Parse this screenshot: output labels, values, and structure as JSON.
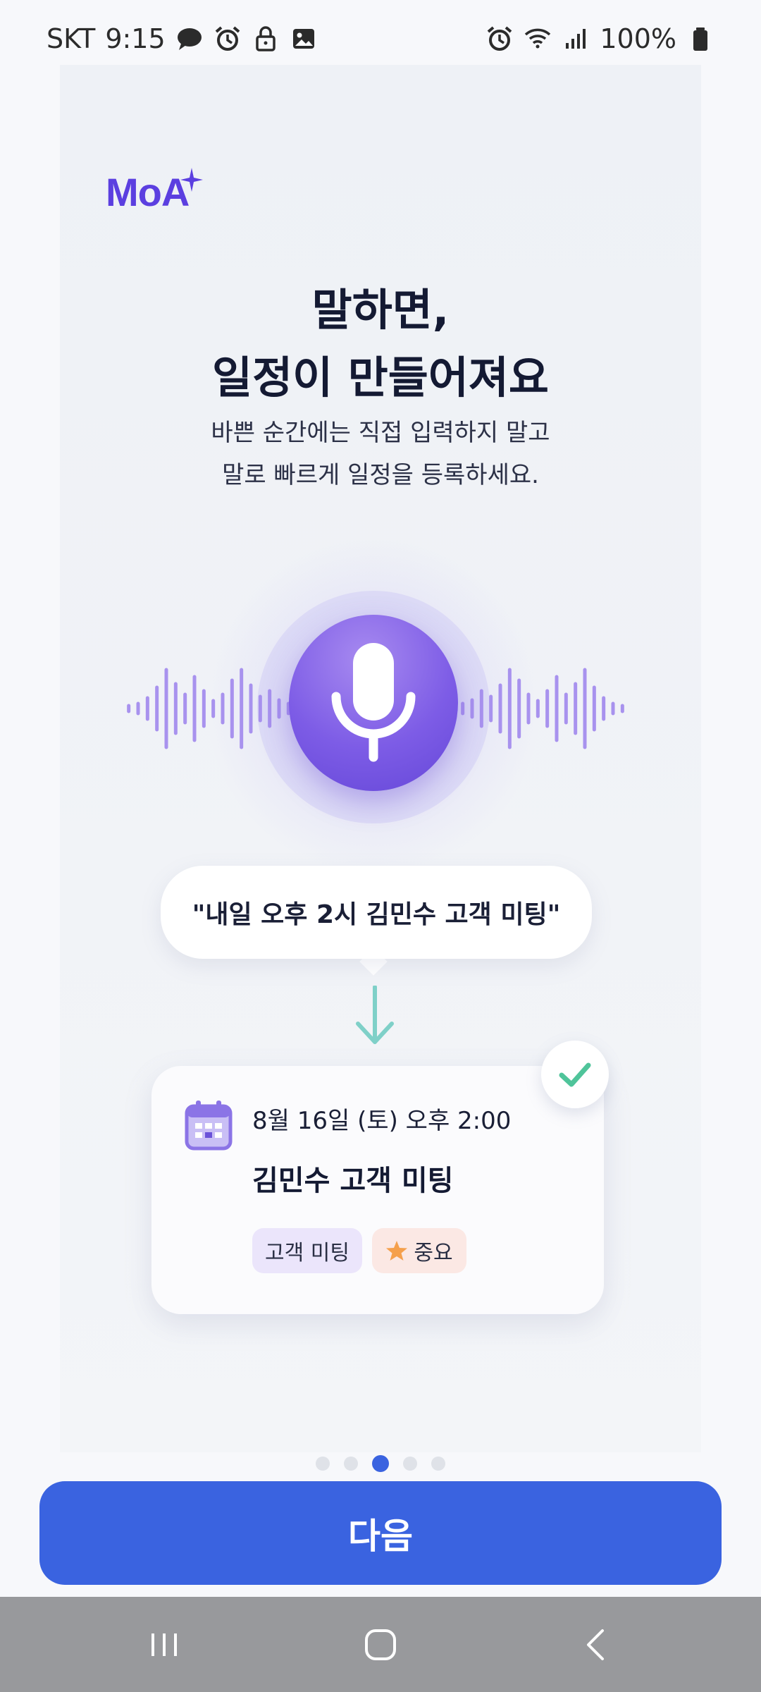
{
  "status_bar": {
    "carrier": "SKT",
    "time": "9:15",
    "battery": "100%",
    "left_icons": [
      "chat-bubble-icon",
      "alarm-icon",
      "lock-icon",
      "gallery-icon"
    ],
    "right_icons": [
      "alarm-icon",
      "wifi-icon",
      "signal-icon",
      "battery-icon"
    ]
  },
  "brand": {
    "logo_text": "MoA",
    "accent_color": "#5b3fe0"
  },
  "onboarding": {
    "headline_line1": "말하면,",
    "headline_line2": "일정이 만들어져요",
    "sub_line1": "바쁜 순간에는 직접 입력하지 말고",
    "sub_line2": "말로 빠르게 일정을 등록하세요.",
    "voice_example": "\"내일 오후 2시 김민수 고객 미팅\"",
    "event": {
      "date": "8월 16일 (토) 오후 2:00",
      "title": "김민수 고객 미팅",
      "tags": [
        "고객 미팅",
        "중요"
      ]
    },
    "page_indicator": {
      "total": 5,
      "current": 3
    }
  },
  "actions": {
    "next_label": "다음",
    "button_color": "#3a63e0"
  },
  "nav_bar": {
    "icons": [
      "recent-apps-icon",
      "home-icon",
      "back-icon"
    ]
  }
}
